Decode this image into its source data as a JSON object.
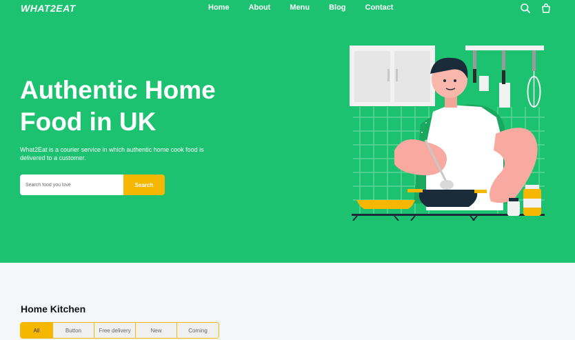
{
  "header": {
    "logo": "WHAT2EAT",
    "nav": [
      "Home",
      "About",
      "Menu",
      "Blog",
      "Contact"
    ],
    "icons": [
      "search-icon",
      "shopping-bag-icon"
    ]
  },
  "hero": {
    "title_line1": "Authentic Home",
    "title_line2": "Food in UK",
    "subtitle": "What2Eat is a courier service in which authentic home cook food is delivered to a customer.",
    "search": {
      "placeholder": "Search food you love",
      "button_label": "Search"
    }
  },
  "section": {
    "title": "Home Kitchen",
    "filters": [
      "All",
      "Button",
      "Free delivery",
      "New",
      "Coming"
    ],
    "active_filter": "All"
  },
  "colors": {
    "primary": "#1dc271",
    "accent": "#f5b700"
  }
}
